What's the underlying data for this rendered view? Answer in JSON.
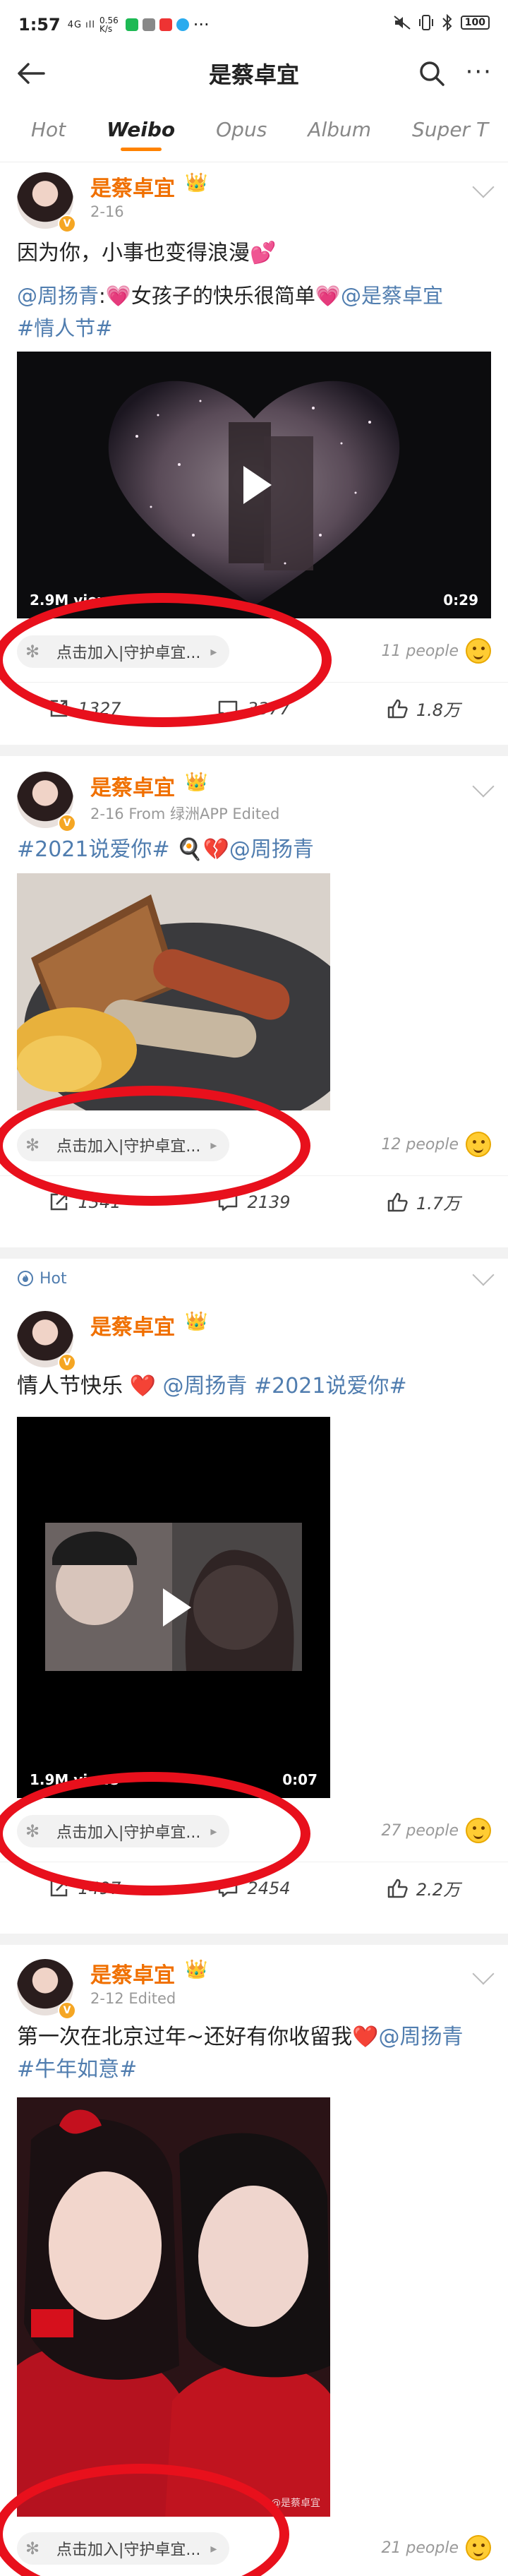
{
  "status_bar": {
    "time": "1:57",
    "signal": "4G ıll",
    "speed_top": "0.56",
    "speed_bottom": "K/s",
    "more": "···",
    "battery": "100"
  },
  "header": {
    "title": "是蔡卓宜",
    "back_icon": "arrow-left-icon",
    "search_icon": "search-icon",
    "more": "···"
  },
  "tabs": [
    "Hot",
    "Weibo",
    "Opus",
    "Album",
    "Super T"
  ],
  "active_tab": "Weibo",
  "posts": [
    {
      "author": "是蔡卓宜",
      "meta": "2-16",
      "text_main": "因为你，小事也变得浪漫💕",
      "share_prefix": "@周扬青",
      "share_text": ":💗女孩子的快乐很简单💗",
      "share_mention": "@是蔡卓宜",
      "share_tag": "#情人节#",
      "video_views": "2.9M views",
      "video_duration": "0:29",
      "support_label": "点击加入|守护卓宜...",
      "likers": "11 people",
      "reposts": "1327",
      "comments": "3377",
      "likes": "1.8万"
    },
    {
      "author": "是蔡卓宜",
      "meta": "2-16  From 绿洲APP  Edited",
      "text_tag": "#2021说爱你#",
      "text_emoji": " 🍳💔",
      "text_mention": "@周扬青",
      "support_label": "点击加入|守护卓宜...",
      "likers": "12 people",
      "reposts": "1341",
      "comments": "2139",
      "likes": "1.7万"
    },
    {
      "hot_label": "Hot",
      "author": "是蔡卓宜",
      "meta": "",
      "text_main": "情人节快乐 ❤️ ",
      "text_mention": "@周扬青",
      "text_tag": " #2021说爱你#",
      "video_views": "1.9M views",
      "video_duration": "0:07",
      "support_label": "点击加入|守护卓宜...",
      "likers": "27 people",
      "reposts": "1497",
      "comments": "2454",
      "likes": "2.2万"
    },
    {
      "author": "是蔡卓宜",
      "meta": "2-12  Edited",
      "text_main": "第一次在北京过年~还好有你收留我❤️",
      "text_mention": "@周扬青",
      "text_tag": "#牛年如意#",
      "watermark": "@是蔡卓宜",
      "support_label": "点击加入|守护卓宜...",
      "likers": "21 people"
    }
  ],
  "colors": {
    "brand_orange": "#ff8200",
    "link_blue": "#507daf",
    "annotation_red": "#e8101c"
  }
}
